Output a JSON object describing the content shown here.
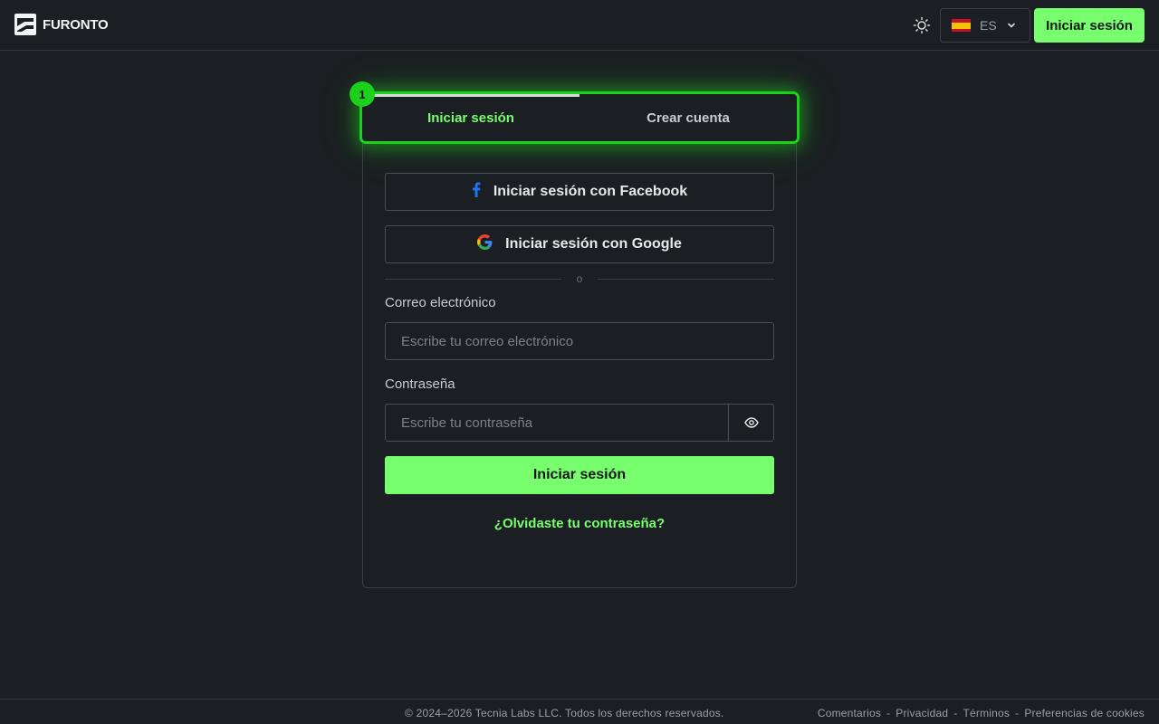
{
  "header": {
    "logo_text": "FURONTO",
    "language_code": "ES",
    "login_button": "Iniciar sesión"
  },
  "auth": {
    "step_number": "1",
    "tabs": [
      {
        "label": "Iniciar sesión",
        "active": true
      },
      {
        "label": "Crear cuenta",
        "active": false
      }
    ],
    "facebook_button": "Iniciar sesión con Facebook",
    "google_button": "Iniciar sesión con Google",
    "divider_text": "o",
    "email_label": "Correo electrónico",
    "email_placeholder": "Escribe tu correo electrónico",
    "email_value": "",
    "password_label": "Contraseña",
    "password_placeholder": "Escribe tu contraseña",
    "password_value": "",
    "submit_button": "Iniciar sesión",
    "forgot_link": "¿Olvidaste tu contraseña?"
  },
  "footer": {
    "copyright": "© 2024–2026 Tecnia Labs LLC. Todos los derechos reservados.",
    "links": [
      "Comentarios",
      "Privacidad",
      "Términos",
      "Preferencias de cookies"
    ],
    "separator": "-"
  },
  "icons": {
    "theme": "sun-icon",
    "language_flag": "spain-flag-icon",
    "language_caret": "chevron-down-icon",
    "facebook": "facebook-icon",
    "google": "google-icon",
    "password_toggle": "eye-icon"
  },
  "colors": {
    "background": "#1b1e22",
    "accent": "#77ff6e",
    "highlight": "#1bd11b",
    "border": "#4a4f55",
    "text": "#e6e8ea"
  }
}
